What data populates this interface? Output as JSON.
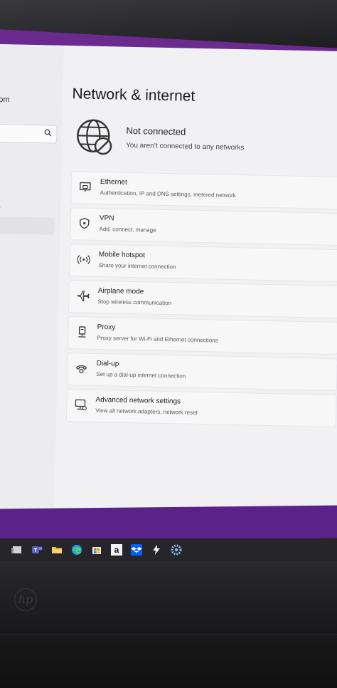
{
  "page": {
    "title": "Network & internet",
    "status_title": "Not connected",
    "status_subtitle": "You aren’t connected to any networks"
  },
  "sidebar": {
    "partial_account_text": "om",
    "partial_item_text": "s"
  },
  "settings_items": [
    {
      "icon": "ethernet-icon",
      "title": "Ethernet",
      "description": "Authentication, IP and DNS settings, metered network"
    },
    {
      "icon": "shield-icon",
      "title": "VPN",
      "description": "Add, connect, manage"
    },
    {
      "icon": "hotspot-icon",
      "title": "Mobile hotspot",
      "description": "Share your internet connection"
    },
    {
      "icon": "airplane-icon",
      "title": "Airplane mode",
      "description": "Stop wireless communication"
    },
    {
      "icon": "proxy-icon",
      "title": "Proxy",
      "description": "Proxy server for Wi-Fi and Ethernet connections"
    },
    {
      "icon": "dialup-icon",
      "title": "Dial-up",
      "description": "Set up a dial-up internet connection"
    },
    {
      "icon": "advanced-network-icon",
      "title": "Advanced network settings",
      "description": "View all network adapters, network reset"
    }
  ],
  "taskbar": {
    "icons": [
      "task-view-icon",
      "teams-icon",
      "file-explorer-icon",
      "edge-icon",
      "store-icon",
      "amazon-icon",
      "dropbox-icon",
      "bolt-icon",
      "settings-icon"
    ],
    "amazon_label": "a"
  },
  "colors": {
    "accent_purple": "#6a2a8e",
    "screen_bg": "#f1f1f3",
    "card_bg": "#f7f7f8"
  }
}
